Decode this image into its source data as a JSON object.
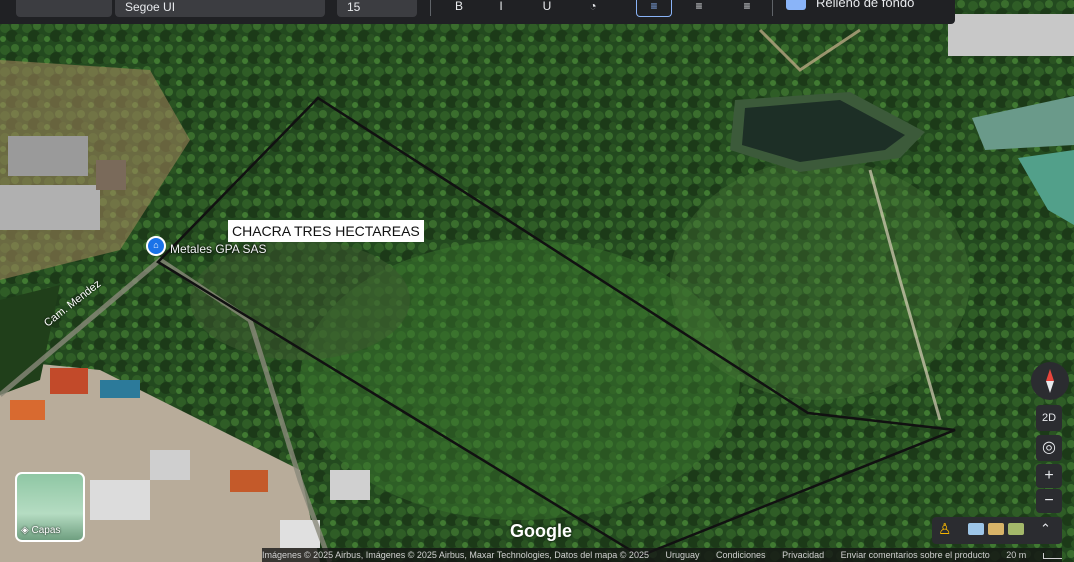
{
  "toolbar": {
    "font_select": "Segoe UI",
    "size_select": "15",
    "background_label": "Relleno de fondo"
  },
  "map": {
    "parcel_label": "CHACRA TRES HECTAREAS",
    "business_pin": "Metales GPA SAS",
    "road_label": "Cam. Mendez",
    "logo": "Google",
    "layers_label": "Capas",
    "view_mode": "2D"
  },
  "attribution": {
    "imagery": "Imágenes © 2025 Airbus, Imágenes © 2025 Airbus, Maxar Technologies, Datos del mapa © 2025",
    "uruguay": "Uruguay",
    "terms": "Condiciones",
    "privacy": "Privacidad",
    "feedback": "Enviar comentarios sobre el producto",
    "scale": "20 m"
  },
  "icons": {
    "pin": "shopping-bag-icon",
    "layers": "layers-icon",
    "compass": "compass-icon",
    "locate": "my-location-icon",
    "zoom_in": "plus-icon",
    "zoom_out": "minus-icon",
    "pegman": "pegman-icon",
    "expand": "chevron-up-icon"
  },
  "colors": {
    "parcel_outline": "#111111",
    "pin_blue": "#1a73e8",
    "toolbar": "#202124"
  }
}
